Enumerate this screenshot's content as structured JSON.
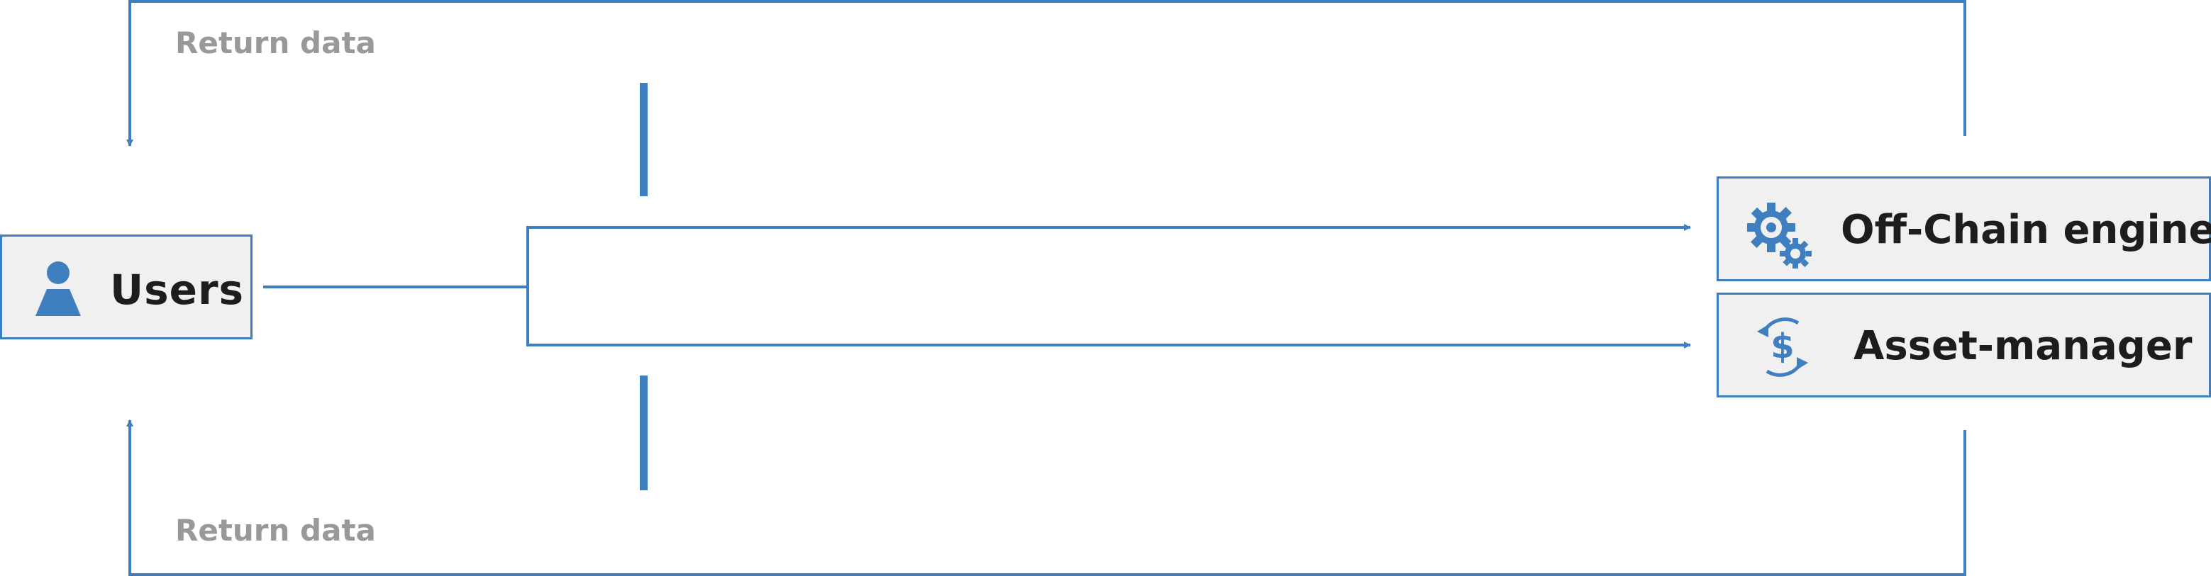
{
  "nodes": {
    "users": {
      "label": "Users",
      "icon": "user-icon"
    },
    "offchain": {
      "label": "Off-Chain engine",
      "icon": "gears-icon"
    },
    "asset_manager": {
      "label": "Asset-manager",
      "icon": "dollar-cycle-icon"
    }
  },
  "edges": {
    "return_top": {
      "label": "Return data"
    },
    "return_bottom": {
      "label": "Return data"
    }
  },
  "colors": {
    "line": "#3f7fc0",
    "box_fill": "#f0f0f0",
    "label_text": "#1d1d1d",
    "return_text": "#999999"
  }
}
